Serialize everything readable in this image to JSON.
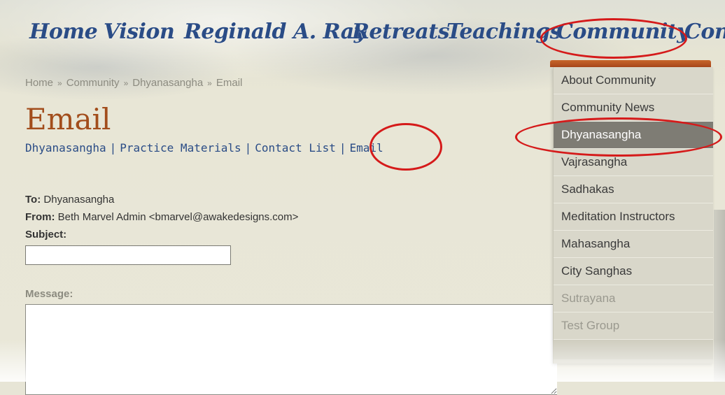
{
  "nav": {
    "items": [
      "Home",
      "Vision",
      "Reginald A. Ray",
      "Retreats",
      "Teachings",
      "Community",
      "Cont"
    ]
  },
  "breadcrumb": {
    "items": [
      "Home",
      "Community",
      "Dhyanasangha",
      "Email"
    ],
    "separator": "»"
  },
  "page_title": "Email",
  "subnav": {
    "links": [
      "Dhyanasangha",
      "Practice Materials",
      "Contact List",
      "Email"
    ],
    "separator": "|"
  },
  "form": {
    "to_label": "To:",
    "to_value": "Dhyanasangha",
    "from_label": "From:",
    "from_value": "Beth Marvel Admin <bmarvel@awakedesigns.com>",
    "subject_label": "Subject:",
    "subject_value": "",
    "message_label": "Message:",
    "message_value": ""
  },
  "dropdown": {
    "items": [
      {
        "label": "About Community",
        "state": "normal"
      },
      {
        "label": "Community News",
        "state": "normal"
      },
      {
        "label": "Dhyanasangha",
        "state": "active"
      },
      {
        "label": "Vajrasangha",
        "state": "normal"
      },
      {
        "label": "Sadhakas",
        "state": "normal"
      },
      {
        "label": "Meditation Instructors",
        "state": "normal"
      },
      {
        "label": "Mahasangha",
        "state": "normal"
      },
      {
        "label": "City Sanghas",
        "state": "normal"
      },
      {
        "label": "Sutrayana",
        "state": "muted"
      },
      {
        "label": "Test Group",
        "state": "muted"
      }
    ]
  },
  "colors": {
    "nav_text": "#2a4c86",
    "title": "#a24d1c",
    "annotation": "#d51a1a",
    "active_item": "#7e7c74"
  }
}
